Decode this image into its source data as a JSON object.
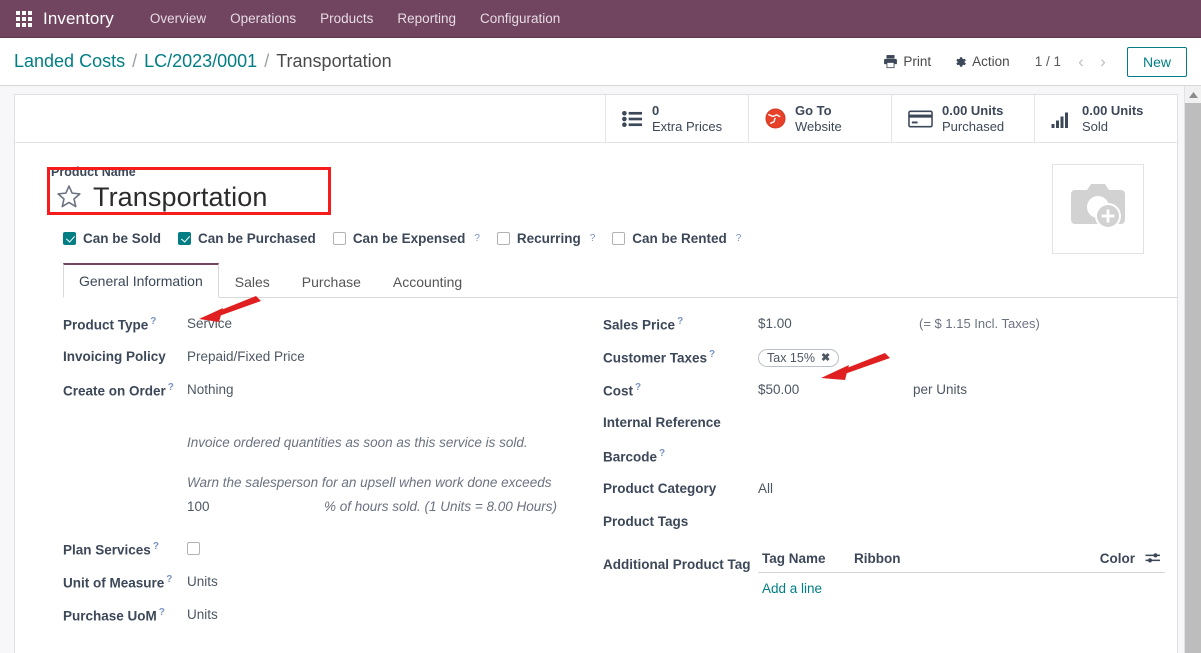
{
  "appbar": {
    "apps_icon": "apps-grid-icon",
    "app_name": "Inventory",
    "menus": [
      "Overview",
      "Operations",
      "Products",
      "Reporting",
      "Configuration"
    ]
  },
  "control_panel": {
    "breadcrumb": {
      "root": "Landed Costs",
      "parent": "LC/2023/0001",
      "current": "Transportation",
      "separator": "/"
    },
    "print_label": "Print",
    "print_icon": "printer-icon",
    "action_label": "Action",
    "action_icon": "gear-icon",
    "pager": "1 / 1",
    "prev_icon": "chevron-left-icon",
    "next_icon": "chevron-right-icon",
    "new_label": "New"
  },
  "smart_buttons": [
    {
      "icon": "list-icon",
      "value": "0",
      "label": "Extra Prices"
    },
    {
      "icon": "globe-icon",
      "value": "Go To",
      "label": "Website"
    },
    {
      "icon": "credit-card-icon",
      "value": "0.00 Units",
      "label": "Purchased"
    },
    {
      "icon": "bar-chart-icon",
      "value": "0.00 Units",
      "label": "Sold"
    }
  ],
  "title": {
    "field_label": "Product Name",
    "star_icon": "star-icon",
    "value": "Transportation",
    "image_placeholder_icon": "camera-add-icon"
  },
  "checkboxes": [
    {
      "label": "Can be Sold",
      "checked": true,
      "help": false
    },
    {
      "label": "Can be Purchased",
      "checked": true,
      "help": false
    },
    {
      "label": "Can be Expensed",
      "checked": false,
      "help": true
    },
    {
      "label": "Recurring",
      "checked": false,
      "help": true
    },
    {
      "label": "Can be Rented",
      "checked": false,
      "help": true
    }
  ],
  "tabs": [
    {
      "label": "General Information",
      "active": true
    },
    {
      "label": "Sales",
      "active": false
    },
    {
      "label": "Purchase",
      "active": false
    },
    {
      "label": "Accounting",
      "active": false
    }
  ],
  "left_fields": {
    "product_type_label": "Product Type",
    "product_type_value": "Service",
    "invoicing_policy_label": "Invoicing Policy",
    "invoicing_policy_value": "Prepaid/Fixed Price",
    "create_on_order_label": "Create on Order",
    "create_on_order_value": "Nothing",
    "invoice_help": "Invoice ordered quantities as soon as this service is sold.",
    "upsell_help": "Warn the salesperson for an upsell when work done exceeds",
    "upsell_value": "100",
    "upsell_suffix": "% of hours sold. (1 Units = 8.00 Hours)",
    "plan_services_label": "Plan Services",
    "plan_services_checked": false,
    "uom_label": "Unit of Measure",
    "uom_value": "Units",
    "purchase_uom_label": "Purchase UoM",
    "purchase_uom_value": "Units"
  },
  "right_fields": {
    "sales_price_label": "Sales Price",
    "sales_price_value": "$1.00",
    "sales_price_hint": "(= $ 1.15 Incl. Taxes)",
    "customer_taxes_label": "Customer Taxes",
    "customer_tax_tag": "Tax 15%",
    "tax_remove_icon": "close-icon",
    "cost_label": "Cost",
    "cost_value": "$50.00",
    "cost_suffix": "per Units",
    "internal_reference_label": "Internal Reference",
    "internal_reference_value": "",
    "barcode_label": "Barcode",
    "barcode_value": "",
    "product_category_label": "Product Category",
    "product_category_value": "All",
    "product_tags_label": "Product Tags",
    "product_tags_value": "",
    "additional_tag_label": "Additional Product Tag",
    "tag_table": {
      "columns": [
        "Tag Name",
        "Ribbon",
        "Color"
      ],
      "settings_icon": "sliders-icon",
      "add_line": "Add a line",
      "rows": []
    }
  },
  "annotations": {
    "highlight_color": "#f81b1b",
    "arrow_color": "#e02020",
    "box_target": "Product Name field",
    "arrow_targets": [
      "Service",
      "$50.00"
    ]
  },
  "scrollbar": {
    "up_icon": "scroll-up-icon"
  }
}
